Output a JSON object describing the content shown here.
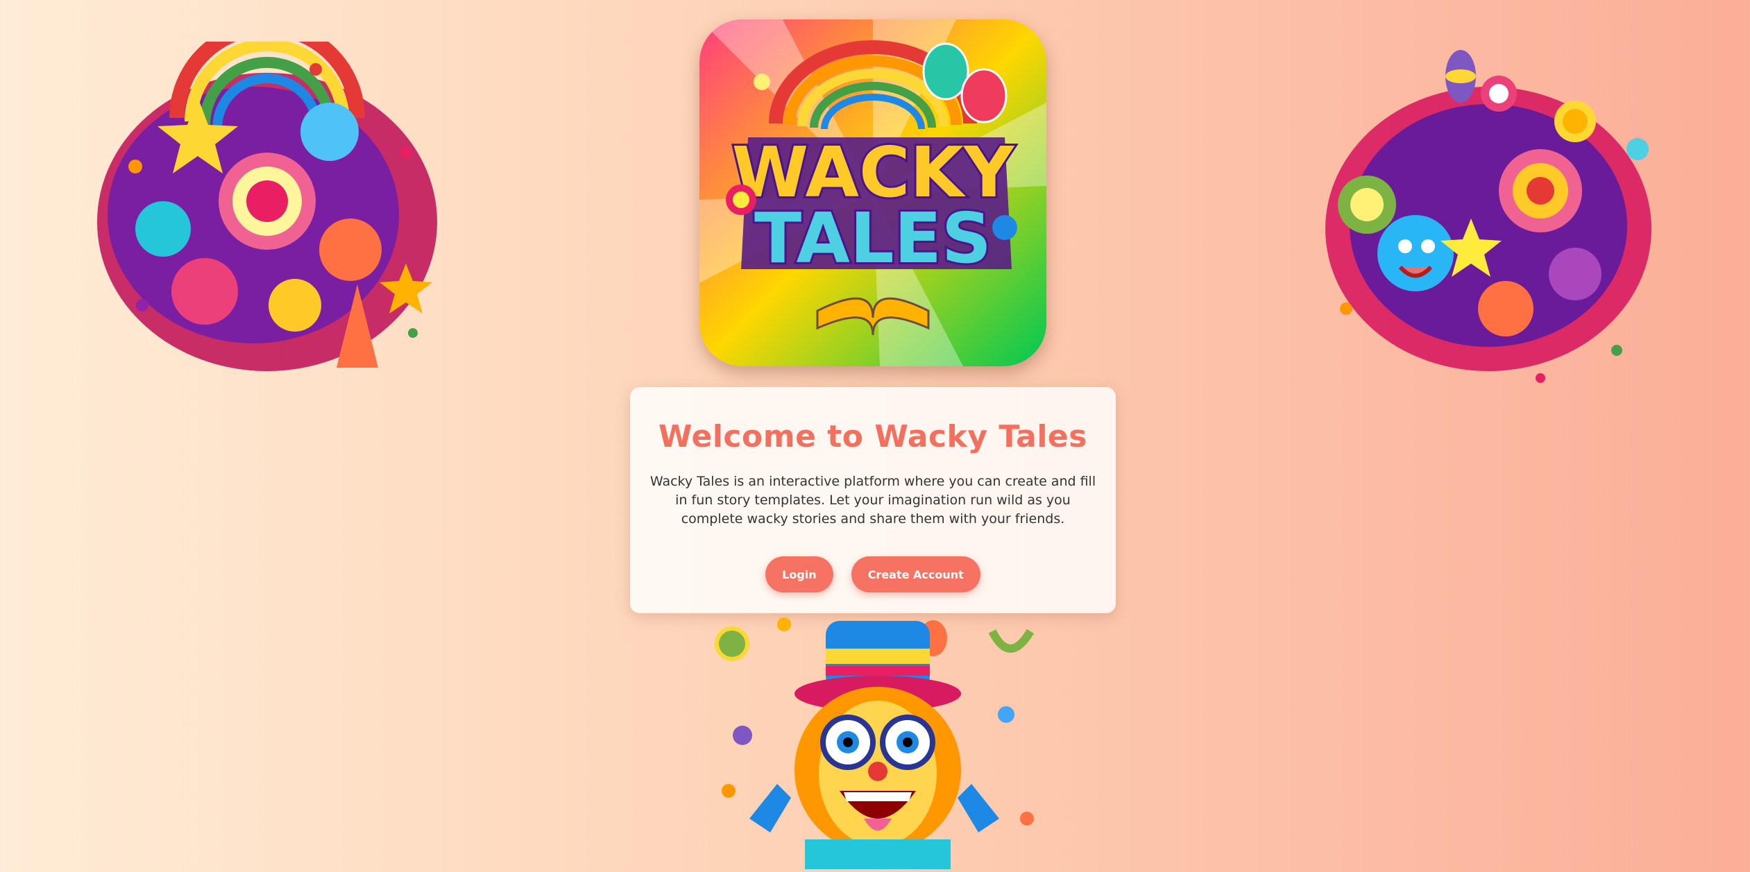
{
  "logo": {
    "line1": "WACKY",
    "line2": "TALES"
  },
  "welcome": {
    "title": "Welcome to Wacky Tales",
    "description": "Wacky Tales is an interactive platform where you can create and fill in fun story templates. Let your imagination run wild as you complete wacky stories and share them with your friends."
  },
  "actions": {
    "login_label": "Login",
    "create_account_label": "Create Account"
  },
  "colors": {
    "accent": "#f4705e",
    "button": "#f67363",
    "bg_left": "#ffecd6",
    "bg_right": "#fbae98"
  }
}
